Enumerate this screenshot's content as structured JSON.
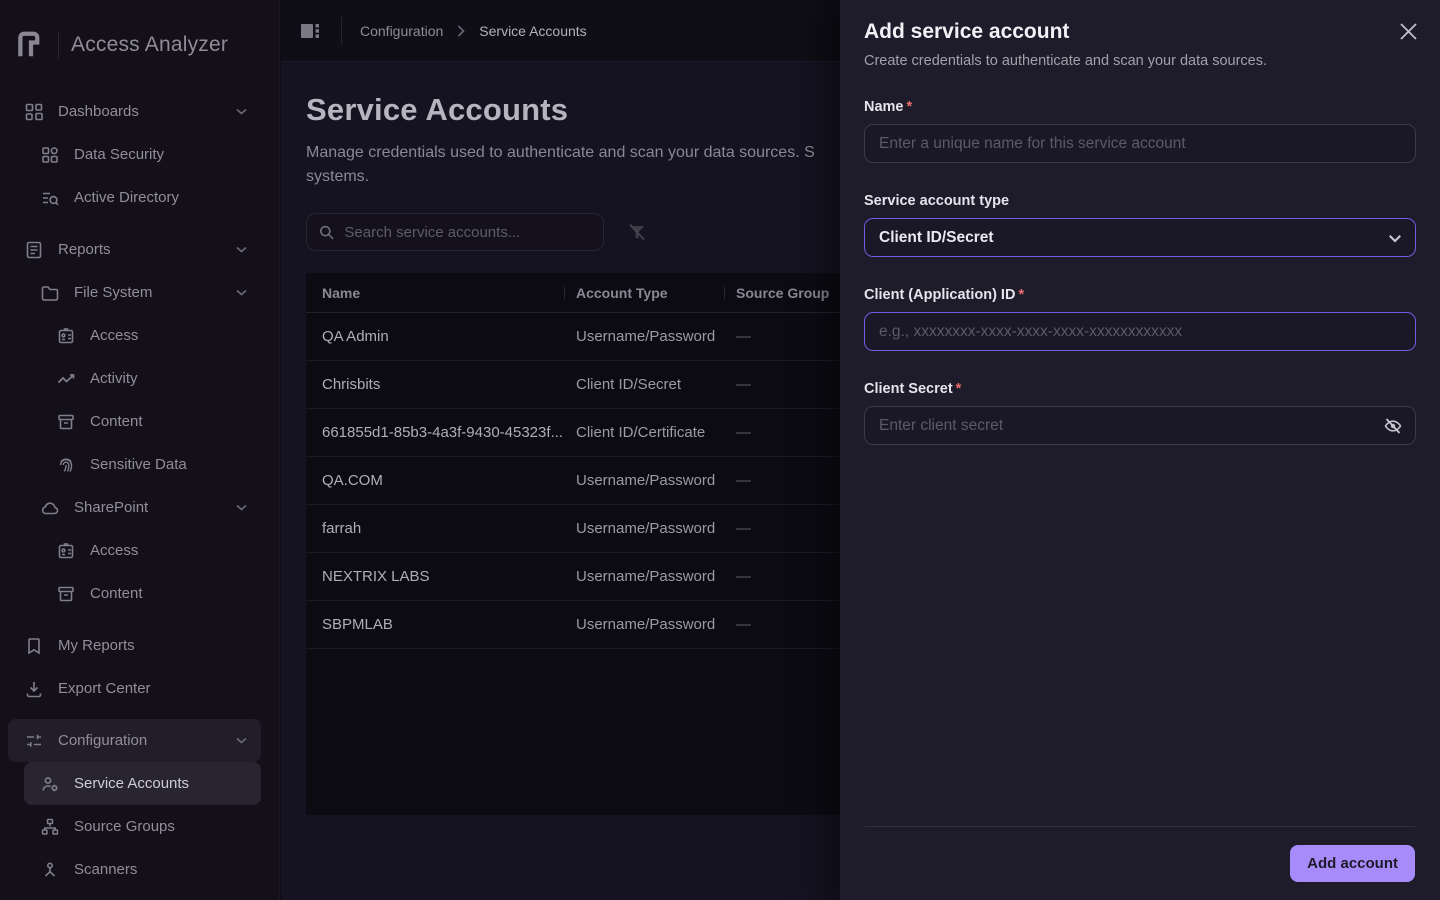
{
  "app": {
    "name": "Access Analyzer"
  },
  "sidebar": {
    "items": [
      {
        "label": "Dashboards"
      },
      {
        "label": "Data Security"
      },
      {
        "label": "Active Directory"
      },
      {
        "label": "Reports"
      },
      {
        "label": "File System"
      },
      {
        "label": "Access"
      },
      {
        "label": "Activity"
      },
      {
        "label": "Content"
      },
      {
        "label": "Sensitive Data"
      },
      {
        "label": "SharePoint"
      },
      {
        "label": "Access"
      },
      {
        "label": "Content"
      },
      {
        "label": "My Reports"
      },
      {
        "label": "Export Center"
      },
      {
        "label": "Configuration"
      },
      {
        "label": "Service Accounts"
      },
      {
        "label": "Source Groups"
      },
      {
        "label": "Scanners"
      }
    ]
  },
  "breadcrumb": {
    "parent": "Configuration",
    "current": "Service Accounts"
  },
  "page": {
    "title": "Service Accounts",
    "description_line1": "Manage credentials used to authenticate and scan your data sources. S",
    "description_line2": "systems."
  },
  "toolbar": {
    "search_placeholder": "Search service accounts..."
  },
  "table": {
    "columns": [
      "Name",
      "Account Type",
      "Source Group"
    ],
    "rows": [
      {
        "name": "QA Admin",
        "account_type": "Username/Password",
        "source_group": "—"
      },
      {
        "name": "Chrisbits",
        "account_type": "Client ID/Secret",
        "source_group": "—"
      },
      {
        "name": "661855d1-85b3-4a3f-9430-45323f...",
        "account_type": "Client ID/Certificate",
        "source_group": "—"
      },
      {
        "name": "QA.COM",
        "account_type": "Username/Password",
        "source_group": "—"
      },
      {
        "name": "farrah",
        "account_type": "Username/Password",
        "source_group": "—"
      },
      {
        "name": "NEXTRIX LABS",
        "account_type": "Username/Password",
        "source_group": "—"
      },
      {
        "name": "SBPMLAB",
        "account_type": "Username/Password",
        "source_group": "—"
      }
    ]
  },
  "drawer": {
    "title": "Add service account",
    "subtitle": "Create credentials to authenticate and scan your data sources.",
    "fields": {
      "name": {
        "label": "Name",
        "required": "*",
        "placeholder": "Enter a unique name for this service account"
      },
      "type": {
        "label": "Service account type",
        "value": "Client ID/Secret"
      },
      "client_id": {
        "label": "Client (Application) ID",
        "required": "*",
        "placeholder": "e.g., xxxxxxxx-xxxx-xxxx-xxxx-xxxxxxxxxxxx"
      },
      "client_secret": {
        "label": "Client Secret",
        "required": "*",
        "placeholder": "Enter client secret"
      }
    },
    "submit_label": "Add account"
  },
  "colors": {
    "accent": "#a78bfa",
    "required_marker": "#ef6e6e",
    "field_focus_border": "#6f5ee0"
  }
}
